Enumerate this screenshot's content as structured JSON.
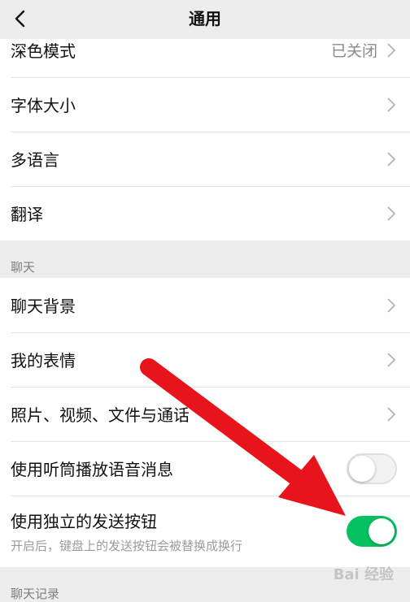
{
  "nav": {
    "title": "通用"
  },
  "group1": {
    "items": [
      {
        "label": "深色模式",
        "value": "已关闭"
      },
      {
        "label": "字体大小"
      },
      {
        "label": "多语言"
      },
      {
        "label": "翻译"
      }
    ]
  },
  "chat_section": {
    "header": "聊天",
    "items": [
      {
        "label": "聊天背景"
      },
      {
        "label": "我的表情"
      },
      {
        "label": "照片、视频、文件与通话"
      },
      {
        "label": "使用听筒播放语音消息",
        "toggle": "off"
      },
      {
        "label": "使用独立的发送按钮",
        "sublabel": "开启后，键盘上的发送按钮会被替换成换行",
        "toggle": "on"
      }
    ]
  },
  "history_section": {
    "header": "聊天记录"
  },
  "watermark": {
    "text": "Bai 经验"
  },
  "colors": {
    "accent": "#07c160",
    "arrow": "#e8141c",
    "background": "#ededed"
  }
}
